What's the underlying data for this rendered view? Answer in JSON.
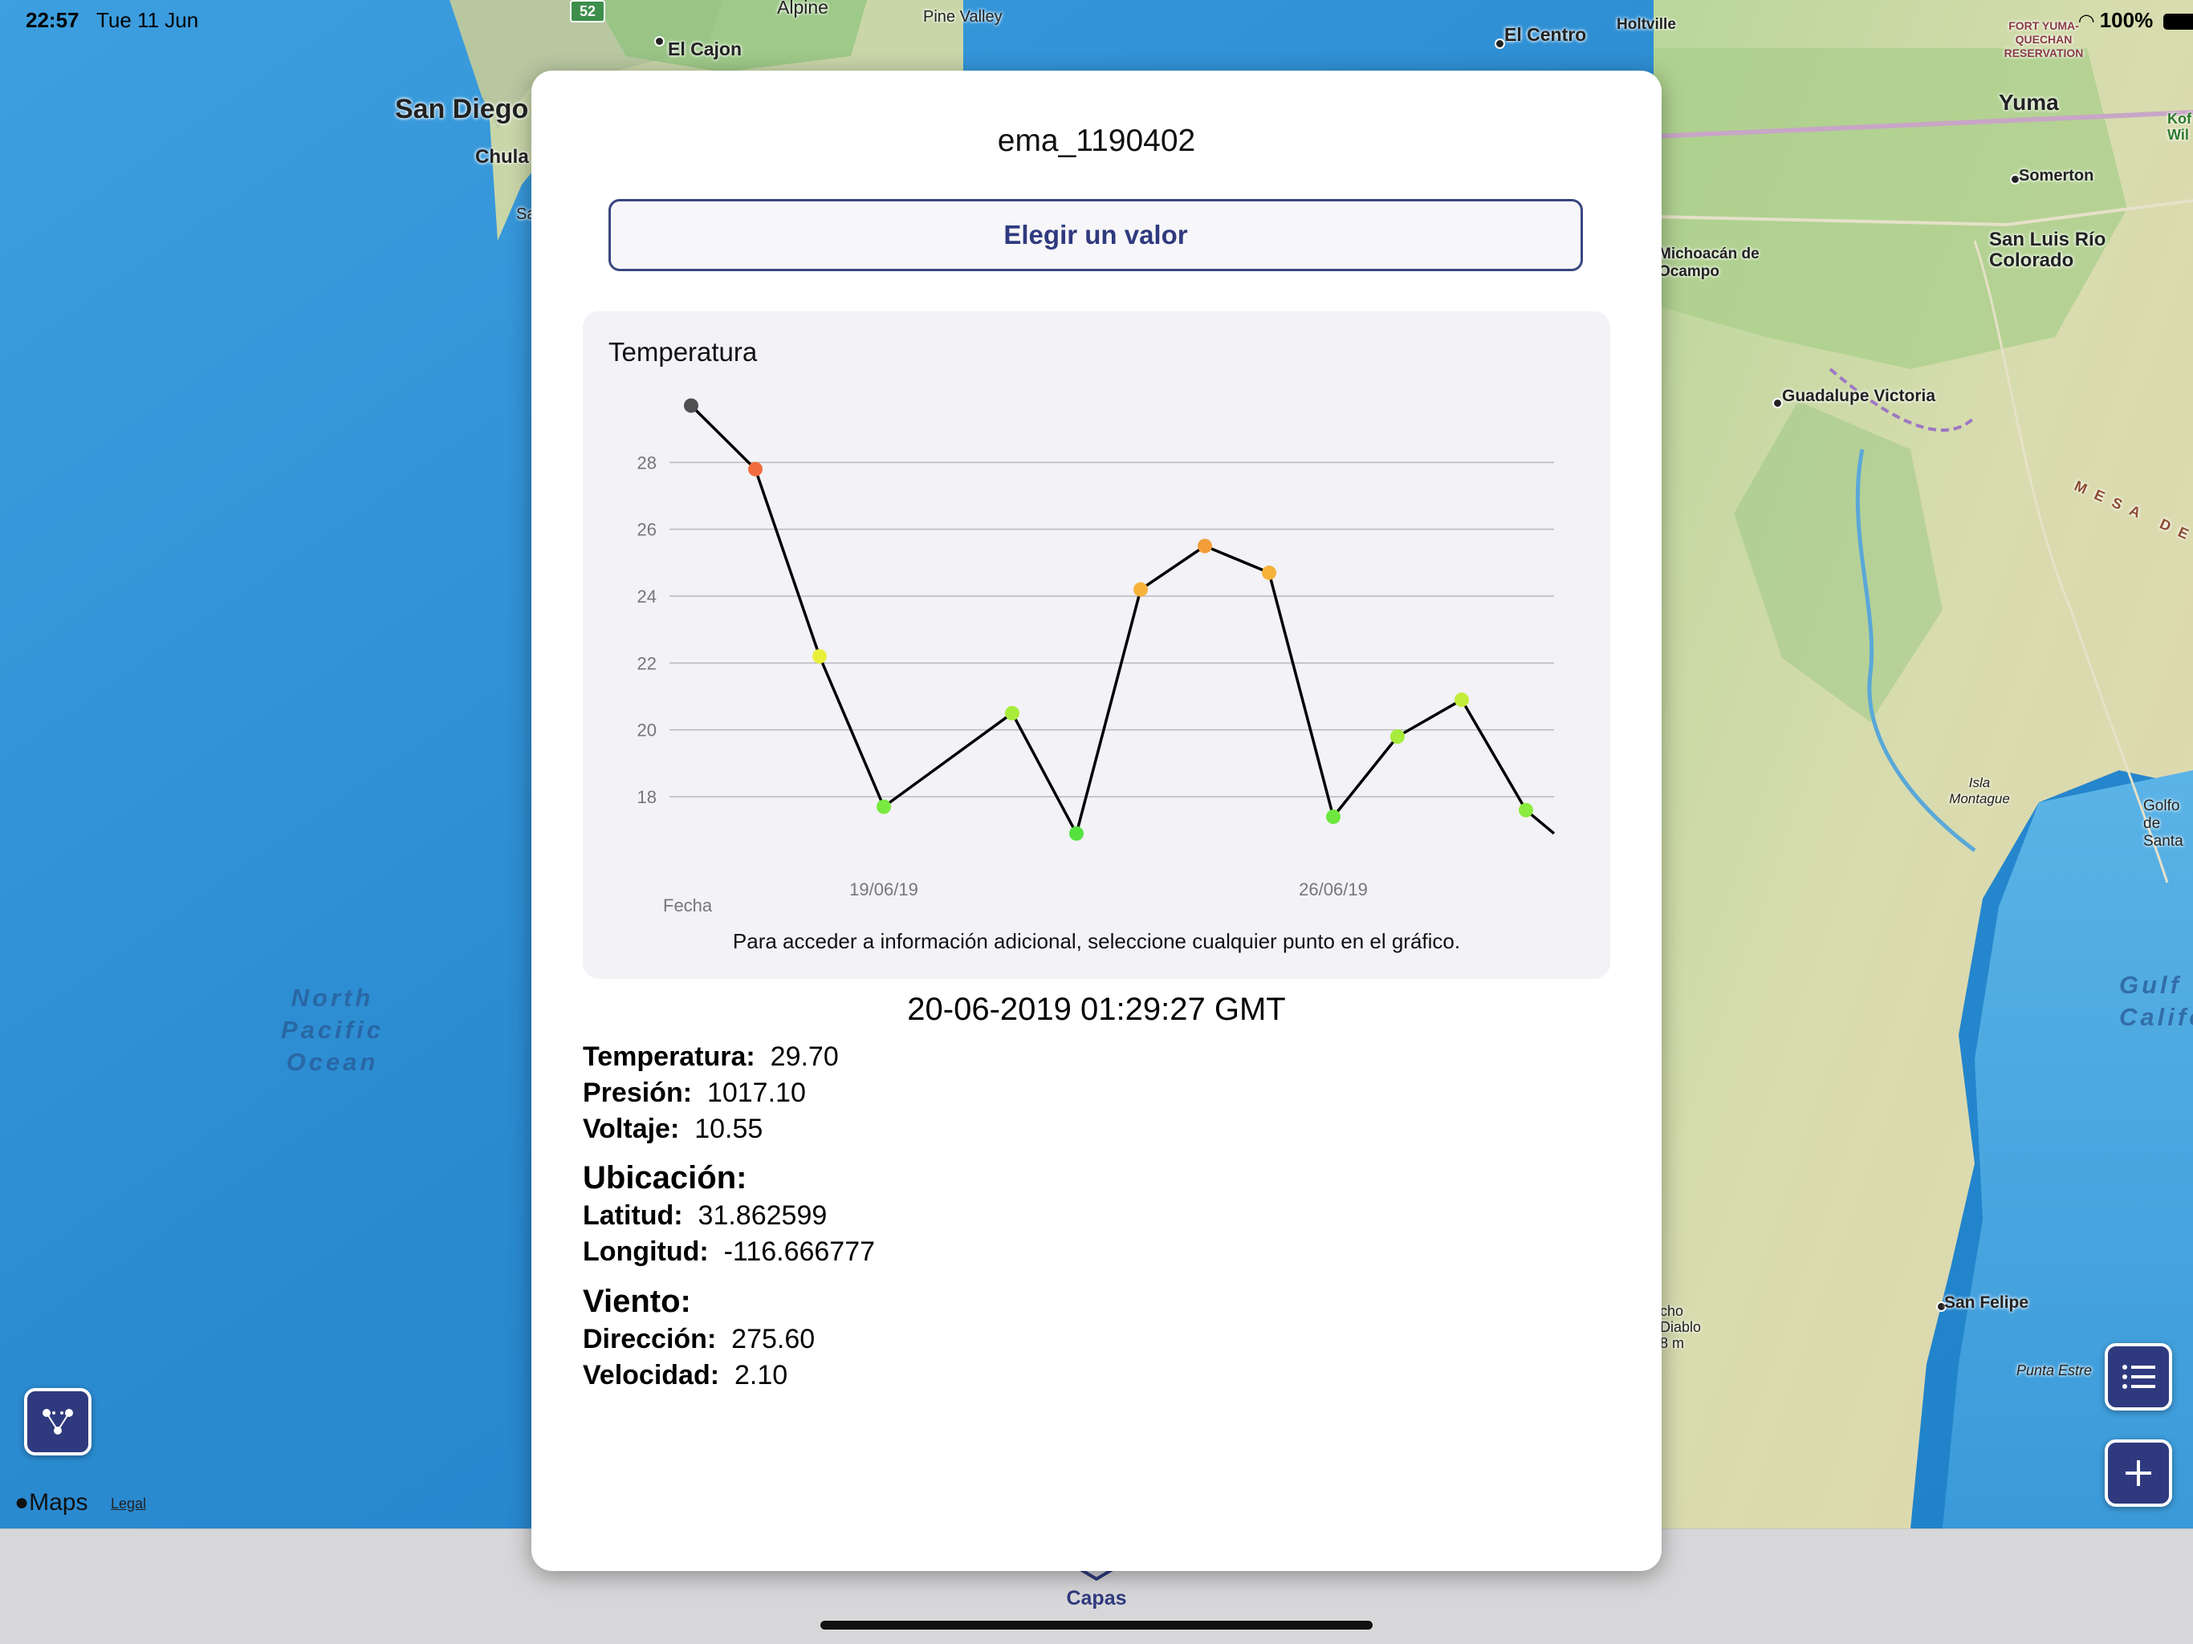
{
  "status_bar": {
    "time": "22:57",
    "date": "Tue 11 Jun",
    "battery": "100%"
  },
  "map": {
    "labels_land": [
      {
        "text": "El Cajon"
      },
      {
        "text": "Alpine"
      },
      {
        "text": "Pine Valley"
      },
      {
        "text": "San Diego"
      },
      {
        "text": "Chula"
      },
      {
        "text": "Sa"
      },
      {
        "text": "El Centro"
      },
      {
        "text": "Holtville"
      },
      {
        "text": "Yuma"
      },
      {
        "text": "Somerton"
      },
      {
        "text": "San Luis Río Colorado"
      },
      {
        "text": "Michoacán de Ocampo"
      },
      {
        "text": "Guadalupe Victoria"
      },
      {
        "text": "Isla Montague"
      },
      {
        "text": "Golfo de Santa"
      },
      {
        "text": "San Felipe"
      },
      {
        "text": "Punta Estre"
      },
      {
        "text": "FORT YUMA-QUECHAN RESERVATION"
      },
      {
        "text": "MESA DE"
      },
      {
        "text": "cho Diablo 8 m"
      },
      {
        "text": "Kof Wil"
      }
    ],
    "ocean_left": "North Pacific Ocean",
    "ocean_right": "Gulf Califo",
    "road_shield": "52",
    "attribution": "Maps",
    "legal": "Legal"
  },
  "modal": {
    "station": "ema_1190402",
    "select_label": "Elegir un valor",
    "chart_hint": "Para acceder a información adicional, seleccione cualquier punto en el gráfico.",
    "selected_datetime": "20-06-2019 01:29:27 GMT",
    "readings": [
      {
        "label": "Temperatura:",
        "value": "29.70"
      },
      {
        "label": "Presión:",
        "value": "1017.10"
      },
      {
        "label": "Voltaje:",
        "value": "10.55"
      }
    ],
    "location_title": "Ubicación:",
    "location": [
      {
        "label": "Latitud:",
        "value": "31.862599"
      },
      {
        "label": "Longitud:",
        "value": "-116.666777"
      }
    ],
    "wind_title": "Viento:",
    "wind": [
      {
        "label": "Dirección:",
        "value": "275.60"
      },
      {
        "label": "Velocidad:",
        "value": "2.10"
      }
    ]
  },
  "chart_data": {
    "type": "line",
    "title": "Temperatura",
    "xlabel": "Fecha",
    "ylabel": "",
    "x_ticks": [
      "19/06/19",
      "26/06/19"
    ],
    "y_ticks": [
      18,
      20,
      22,
      24,
      26,
      28
    ],
    "ylim": [
      16.2,
      30.6
    ],
    "grid": true,
    "legend": "none",
    "points": [
      {
        "x": "16/06/19",
        "y": 29.7,
        "color": "#505050"
      },
      {
        "x": "17/06/19",
        "y": 27.8,
        "color": "#f26d3d"
      },
      {
        "x": "18/06/19",
        "y": 22.2,
        "color": "#e8ef3a"
      },
      {
        "x": "19/06/19",
        "y": 17.7,
        "color": "#79ea3f"
      },
      {
        "x": "21/06/19",
        "y": 20.5,
        "color": "#a7ec3a"
      },
      {
        "x": "22/06/19",
        "y": 16.9,
        "color": "#55e23f"
      },
      {
        "x": "23/06/19",
        "y": 24.2,
        "color": "#f6b23a"
      },
      {
        "x": "24/06/19",
        "y": 25.5,
        "color": "#f39d3a"
      },
      {
        "x": "25/06/19",
        "y": 24.7,
        "color": "#f6b23a"
      },
      {
        "x": "26/06/19",
        "y": 17.4,
        "color": "#6fe63f"
      },
      {
        "x": "27/06/19",
        "y": 19.8,
        "color": "#a7ec3a"
      },
      {
        "x": "28/06/19",
        "y": 20.9,
        "color": "#c2ed3a"
      },
      {
        "x": "29/06/19",
        "y": 17.6,
        "color": "#8aeb3e"
      }
    ],
    "tail_y": 16.9
  },
  "tab": {
    "label": "Capas"
  }
}
